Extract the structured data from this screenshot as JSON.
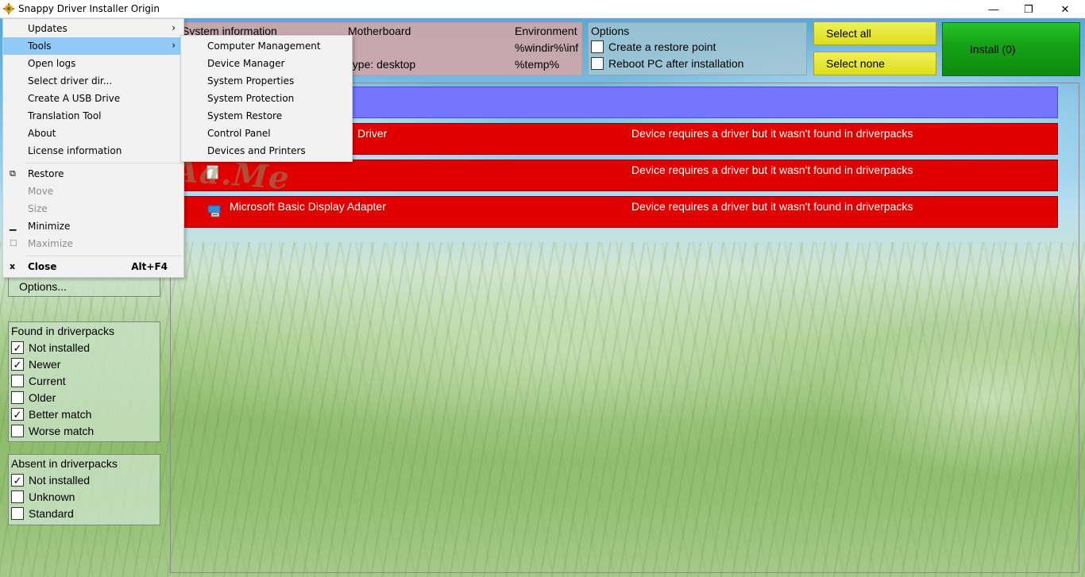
{
  "window": {
    "title": "Snappy Driver Installer Origin",
    "minimize_glyph": "—",
    "restore_glyph": "❐",
    "close_glyph": "✕"
  },
  "system_info": {
    "label": "System information",
    "motherboard_label": "Motherboard",
    "environment_label": "Environment",
    "type_text": "Type: desktop",
    "env_windir": "%windir%\\inf",
    "env_temp": "%temp%"
  },
  "options": {
    "title": "Options",
    "restore_point": {
      "label": "Create a restore point",
      "checked": false
    },
    "reboot": {
      "label": "Reboot PC after installation",
      "checked": false
    }
  },
  "buttons": {
    "select_all": "Select all",
    "select_none": "Select none",
    "install": "Install (0)",
    "options": "Options..."
  },
  "devices": [
    {
      "name": "Driver",
      "status": "Device requires a driver but it wasn't found in driverpacks"
    },
    {
      "name": "",
      "status": "Device requires a driver but it wasn't found in driverpacks"
    },
    {
      "name": "Microsoft Basic Display Adapter",
      "status": "Device requires a driver but it wasn't found in driverpacks"
    }
  ],
  "found_filters": {
    "title": "Found in driverpacks",
    "items": [
      {
        "label": "Not installed",
        "checked": true
      },
      {
        "label": "Newer",
        "checked": true
      },
      {
        "label": "Current",
        "checked": false
      },
      {
        "label": "Older",
        "checked": false
      },
      {
        "label": "Better match",
        "checked": true
      },
      {
        "label": "Worse match",
        "checked": false
      }
    ]
  },
  "absent_filters": {
    "title": "Absent in driverpacks",
    "items": [
      {
        "label": "Not installed",
        "checked": true
      },
      {
        "label": "Unknown",
        "checked": false
      },
      {
        "label": "Standard",
        "checked": false
      }
    ]
  },
  "menu": {
    "items": [
      {
        "label": "Updates",
        "submenu": true
      },
      {
        "label": "Tools",
        "submenu": true,
        "highlighted": true
      },
      {
        "label": "Open logs"
      },
      {
        "label": "Select driver dir..."
      },
      {
        "label": "Create A USB Drive"
      },
      {
        "label": "Translation Tool"
      },
      {
        "label": "About"
      },
      {
        "label": "License information"
      }
    ],
    "window_items": [
      {
        "label": "Restore",
        "glyph": "⧉",
        "disabled": false
      },
      {
        "label": "Move",
        "disabled": true
      },
      {
        "label": "Size",
        "disabled": true
      },
      {
        "label": "Minimize",
        "glyph": "▁",
        "disabled": false
      },
      {
        "label": "Maximize",
        "glyph": "☐",
        "disabled": true
      }
    ],
    "close": {
      "label": "Close",
      "glyph": "x",
      "accelerator": "Alt+F4"
    },
    "arrow_glyph": "›"
  },
  "tools_submenu": [
    "Computer Management",
    "Device Manager",
    "System Properties",
    "System Protection",
    "System Restore",
    "Control Panel",
    "Devices and Printers"
  ],
  "watermark": "KuyhAa.Me",
  "check_glyph": "✓"
}
